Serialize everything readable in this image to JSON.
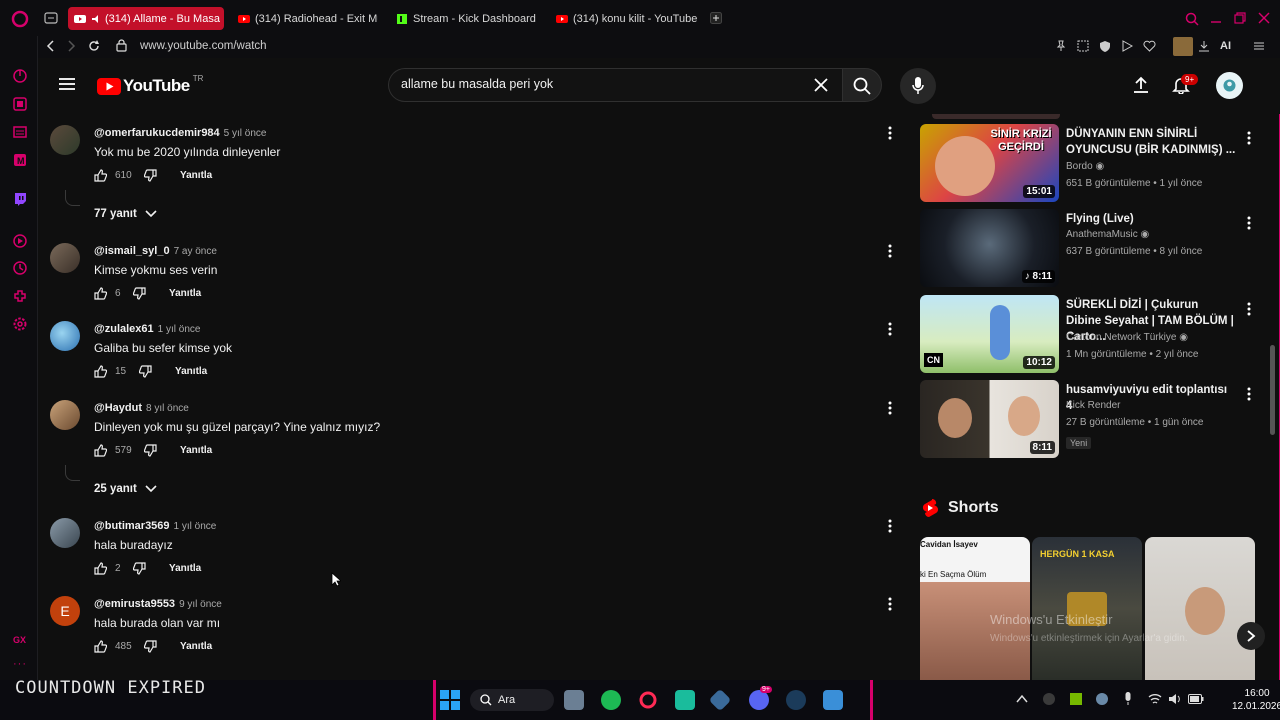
{
  "browser": {
    "tabs": [
      {
        "label": "(314) Allame - Bu Masa"
      },
      {
        "label": "(314) Radiohead - Exit Mu"
      },
      {
        "label": "Stream - Kick Dashboard"
      },
      {
        "label": "(314) konu kilit - YouTube"
      }
    ],
    "url": "www.youtube.com/watch",
    "ai_label": "AI"
  },
  "youtube": {
    "logo_text": "YouTube",
    "region": "TR",
    "search_value": "allame bu masalda peri yok",
    "notif_count": "9+"
  },
  "comments": [
    {
      "user": "@omerfarukucdemir984",
      "ago": "5 yıl önce",
      "text": "Yok mu be 2020 yılında dinleyenler",
      "likes": "610",
      "reply": "Yanıtla",
      "replies": "77 yanıt"
    },
    {
      "user": "@ismail_syl_0",
      "ago": "7 ay önce",
      "text": "Kimse yokmu ses verin",
      "likes": "6",
      "reply": "Yanıtla"
    },
    {
      "user": "@zulalex61",
      "ago": "1 yıl önce",
      "text": "Galiba bu sefer kimse yok",
      "likes": "15",
      "reply": "Yanıtla"
    },
    {
      "user": "@Haydut",
      "ago": "8 yıl önce",
      "text": "Dinleyen yok mu şu güzel parçayı? Yine yalnız mıyız?",
      "likes": "579",
      "reply": "Yanıtla",
      "replies": "25 yanıt"
    },
    {
      "user": "@butimar3569",
      "ago": "1 yıl önce",
      "text": "hala buradayız",
      "likes": "2",
      "reply": "Yanıtla"
    },
    {
      "user": "@emirusta9553",
      "ago": "9 yıl önce",
      "text": "hala burada olan var mı",
      "likes": "485",
      "reply": "Yanıtla",
      "avatar_letter": "E"
    }
  ],
  "related": [
    {
      "title": "DÜNYANIN ENN SİNİRLİ OYUNCUSU (BİR KADINMIŞ) ...",
      "channel": "Bordo",
      "meta": "651 B görüntüleme • 1 yıl önce",
      "duration": "15:01",
      "thumb_text": "SİNİR KRİZİ GEÇİRDİ"
    },
    {
      "title": "Flying (Live)",
      "channel": "AnathemaMusic",
      "meta": "637 B görüntüleme • 8 yıl önce",
      "duration": "8:11"
    },
    {
      "title": "SÜREKLİ DİZİ | Çukurun Dibine Seyahat | TAM BÖLÜM | Carto...",
      "channel": "Cartoon Network Türkiye",
      "meta": "1 Mn görüntüleme • 2 yıl önce",
      "duration": "10:12"
    },
    {
      "title": "husamviyuviyu edit toplantısı 4",
      "channel": "Kick Render",
      "meta": "27 B görüntüleme • 1 gün önce",
      "duration": "8:11",
      "badge": "Yeni"
    }
  ],
  "shorts": {
    "title": "Shorts",
    "items": [
      {
        "caption": "Cavidan İsayev",
        "sub": "ki En Saçma Ölüm"
      },
      {
        "caption": "HERGÜN 1 KASA"
      },
      {
        "caption": ""
      }
    ]
  },
  "overlay": {
    "countdown": "COUNTDOWN EXPIRED",
    "watermark": "Windows'u Etkinleştir",
    "watermark_sub": "Windows'u etkinleştirmek için Ayarlar'a gidin."
  },
  "taskbar": {
    "search_label": "Ara",
    "time": "16:00",
    "date": "12.01.2026",
    "discord_badge": "9+"
  },
  "colors": {
    "accent": "#d6006b",
    "yt_red": "#ff0000",
    "tab_active": "#c3102a"
  }
}
